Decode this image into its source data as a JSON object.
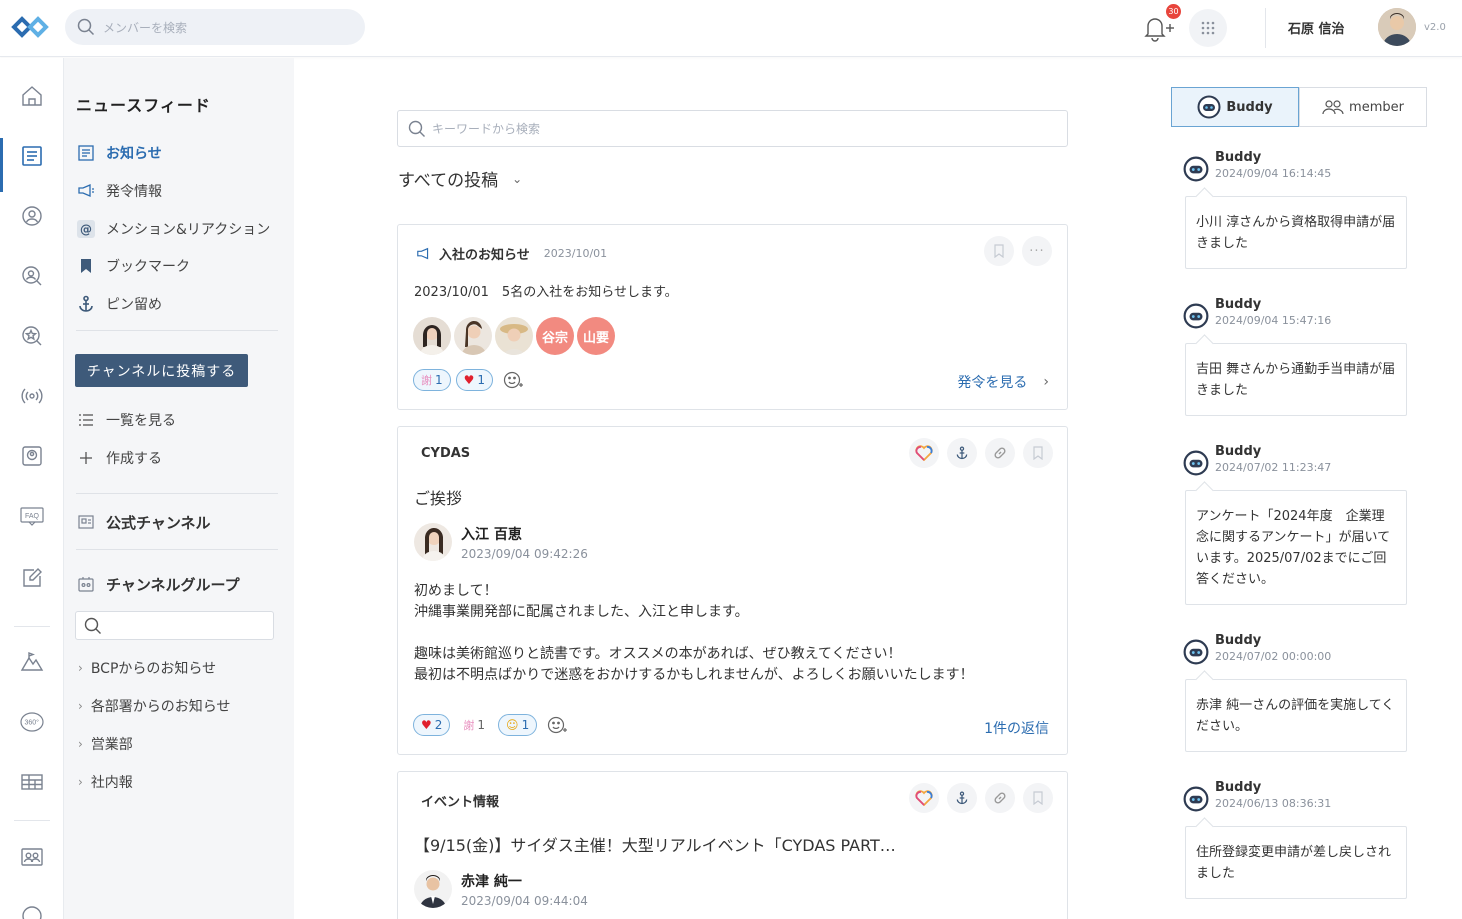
{
  "header": {
    "member_search_placeholder": "メンバーを検索",
    "notification_count": "30",
    "user_name": "石原 信治",
    "version": "v2.0"
  },
  "nav": {
    "title": "ニュースフィード",
    "items": [
      {
        "label": "お知らせ",
        "icon": "news-icon",
        "active": true
      },
      {
        "label": "発令情報",
        "icon": "megaphone-icon"
      },
      {
        "label": "メンション&リアクション",
        "icon": "at-icon"
      },
      {
        "label": "ブックマーク",
        "icon": "bookmark-icon"
      },
      {
        "label": "ピン留め",
        "icon": "pin-icon"
      }
    ],
    "post_button": "チャンネルに投稿する",
    "list_label": "一覧を見る",
    "create_label": "作成する",
    "official_channel": "公式チャンネル",
    "channel_group": "チャンネルグループ",
    "groups": [
      "BCPからのお知らせ",
      "各部署からのお知らせ",
      "営業部",
      "社内報"
    ]
  },
  "feed": {
    "search_placeholder": "キーワードから検索",
    "filter_label": "すべての投稿",
    "cards": [
      {
        "channel": "入社のお知らせ",
        "date": "2023/10/01",
        "body": "2023/10/01　5名の入社をお知らせします。",
        "avatar_texts": [
          "谷宗",
          "山要"
        ],
        "reactions": [
          {
            "emoji": "謝",
            "count": "1"
          },
          {
            "emoji": "♥",
            "count": "1"
          }
        ],
        "link": "発令を見る"
      },
      {
        "channel": "CYDAS",
        "title": "ご挨拶",
        "author": "入江 百恵",
        "time": "2023/09/04 09:42:26",
        "body": "初めまして！\n沖縄事業開発部に配属されました、入江と申します。\n\n趣味は美術館巡りと読書です。オススメの本があれば、ぜひ教えてください！\n最初は不明点ばかりで迷惑をおかけするかもしれませんが、よろしくお願いいたします！",
        "reactions": [
          {
            "emoji": "♥",
            "count": "2"
          },
          {
            "emoji": "謝",
            "count": "1"
          },
          {
            "emoji": "☺",
            "count": "1"
          }
        ],
        "link": "1件の返信"
      },
      {
        "channel": "イベント情報",
        "title": "【9/15(金)】サイダス主催！大型リアルイベント「CYDAS PART…",
        "author": "赤津 純一",
        "time": "2023/09/04 09:44:04"
      }
    ]
  },
  "right": {
    "tabs": [
      "Buddy",
      "member"
    ],
    "messages": [
      {
        "name": "Buddy",
        "time": "2024/09/04 16:14:45",
        "text": "小川 淳さんから資格取得申請が届きました"
      },
      {
        "name": "Buddy",
        "time": "2024/09/04 15:47:16",
        "text": "吉田 舞さんから通勤手当申請が届きました"
      },
      {
        "name": "Buddy",
        "time": "2024/07/02 11:23:47",
        "text": "アンケート「2024年度　企業理念に関するアンケート」が届いています。2025/07/02までにご回答ください。"
      },
      {
        "name": "Buddy",
        "time": "2024/07/02 00:00:00",
        "text": "赤津 純一さんの評価を実施してください。"
      },
      {
        "name": "Buddy",
        "time": "2024/06/13 08:36:31",
        "text": "住所登録変更申請が差し戻しされました"
      }
    ]
  },
  "colors": {
    "accent": "#2b6cb0",
    "post_button": "#3e5a7a",
    "badge": "#e8453c",
    "avatar_text_bg": "#f28a80"
  }
}
